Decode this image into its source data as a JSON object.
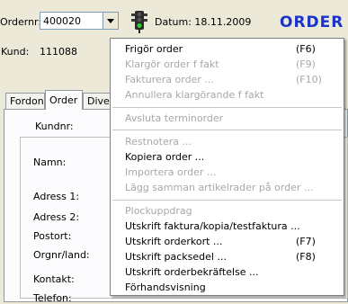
{
  "header": {
    "ordernr_label": "Ordernr:",
    "ordernr_value": "400020",
    "datum_label": "Datum: 18.11.2009",
    "title": "ORDER"
  },
  "customer": {
    "kund_label": "Kund:",
    "kund_value": "111088"
  },
  "tabs": [
    {
      "label": "Fordon"
    },
    {
      "label": "Order"
    },
    {
      "label": "Dive"
    }
  ],
  "form": {
    "kundnr_label": "Kundnr:",
    "namn_label": "Namn:",
    "adress1_label": "Adress 1:",
    "adress2_label": "Adress 2:",
    "postort_label": "Postort:",
    "orgnr_label": "Orgnr/land:",
    "kontakt_label": "Kontakt:",
    "telefon_label": "Telefon:"
  },
  "menu": {
    "items": [
      {
        "label": "Frigör order",
        "shortcut": "(F6)",
        "enabled": true
      },
      {
        "label": "Klargör order f fakt",
        "shortcut": "(F9)",
        "enabled": false
      },
      {
        "label": "Fakturera order ...",
        "shortcut": "(F10)",
        "enabled": false
      },
      {
        "label": "Annullera klargörande f fakt",
        "shortcut": "",
        "enabled": false
      },
      {
        "label": "Avsluta terminorder",
        "shortcut": "",
        "enabled": false
      },
      {
        "label": "Restnotera ...",
        "shortcut": "",
        "enabled": false
      },
      {
        "label": "Kopiera order ...",
        "shortcut": "",
        "enabled": true
      },
      {
        "label": "Importera order ...",
        "shortcut": "",
        "enabled": false
      },
      {
        "label": "Lägg samman artikelrader på order ...",
        "shortcut": "",
        "enabled": false
      },
      {
        "label": "Plockuppdrag",
        "shortcut": "",
        "enabled": false
      },
      {
        "label": "Utskrift faktura/kopia/testfaktura ...",
        "shortcut": "",
        "enabled": true
      },
      {
        "label": "Utskrift orderkort ...",
        "shortcut": "(F7)",
        "enabled": true
      },
      {
        "label": "Utskrift packsedel ...",
        "shortcut": "(F8)",
        "enabled": true
      },
      {
        "label": "Utskrift orderbekräftelse ...",
        "shortcut": "",
        "enabled": true
      },
      {
        "label": "Förhandsvisning",
        "shortcut": "",
        "enabled": true
      }
    ]
  },
  "colors": {
    "title": "#1a33c8",
    "disabled_text": "#a8a8a8",
    "background": "#ece9d8"
  },
  "icons": {
    "ordernr_dropdown": "chevron-down-icon",
    "status": "traffic-light-icon"
  }
}
